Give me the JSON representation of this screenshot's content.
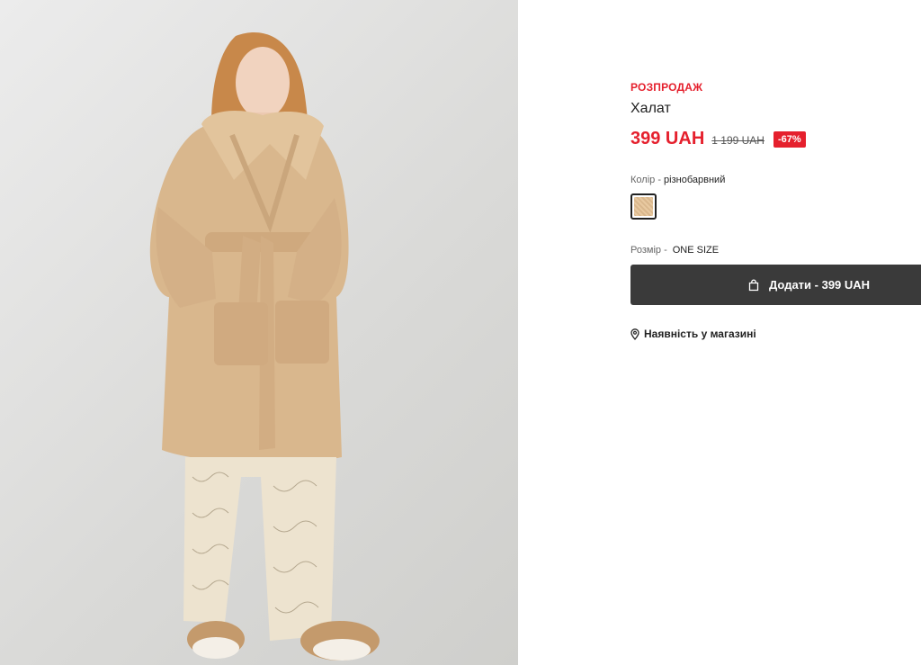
{
  "product": {
    "sale_label": "РОЗПРОДАЖ",
    "title": "Халат",
    "price_now": "399 UAH",
    "price_old": "1 199 UAH",
    "discount": "-67%",
    "color_label": "Колір",
    "color_sep": " - ",
    "color_value": "різнобарвний",
    "size_label": "Розмір -",
    "size_value": "ONE SIZE",
    "add_button_label": "Додати - 399 UAH",
    "stores_link": "Наявність у магазині"
  },
  "colors": {
    "accent": "#e5202d",
    "button_bg": "#3a3a3a",
    "robe": "#d9b78d"
  },
  "icons": {
    "bag": "shopping-bag-icon",
    "location": "location-pin-icon"
  }
}
